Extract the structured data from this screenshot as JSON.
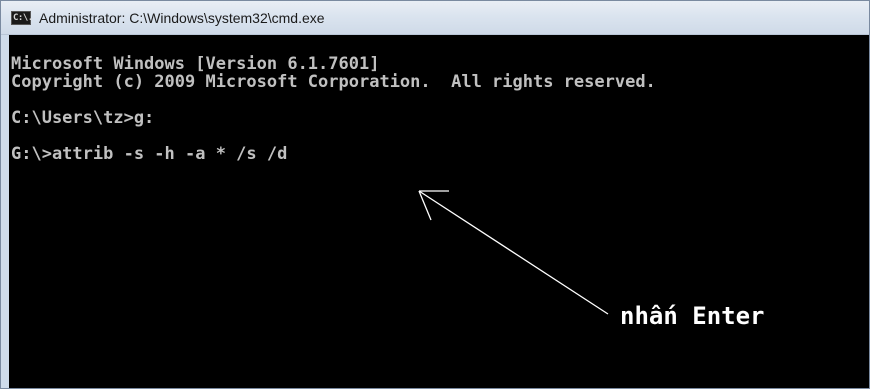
{
  "window": {
    "title": "Administrator: C:\\Windows\\system32\\cmd.exe",
    "icon": "cmd-icon",
    "icon_text": "C:\\."
  },
  "console": {
    "lines": [
      "Microsoft Windows [Version 6.1.7601]",
      "Copyright (c) 2009 Microsoft Corporation.  All rights reserved.",
      "",
      "C:\\Users\\tz>g:",
      "",
      "G:\\>attrib -s -h -a * /s /d"
    ]
  },
  "annotation": {
    "text": "nhấn Enter",
    "color": "#ffffff"
  },
  "colors": {
    "console_bg": "#000000",
    "console_fg": "#c0c0c0",
    "titlebar": "#dbe4ef"
  }
}
